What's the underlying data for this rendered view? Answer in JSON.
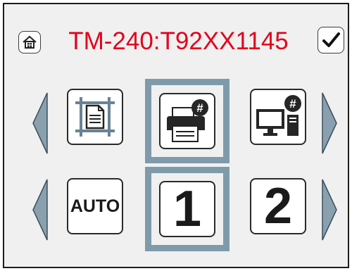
{
  "header": {
    "title": "TM-240:T92XX1145",
    "title_color": "#e3001b",
    "home_icon": "home-icon",
    "confirm_icon": "checkmark-icon"
  },
  "row1": {
    "left_arrow_icon": "left-arrow-icon",
    "right_arrow_icon": "right-arrow-icon",
    "items": [
      {
        "icon": "document-layout-icon",
        "badge": ""
      },
      {
        "icon": "printer-icon",
        "badge": "#"
      },
      {
        "icon": "computer-icon",
        "badge": "#"
      }
    ],
    "selected_index": 1
  },
  "row2": {
    "left_arrow_icon": "left-arrow-icon",
    "right_arrow_icon": "right-arrow-icon",
    "items": [
      {
        "label": "AUTO"
      },
      {
        "label": "1"
      },
      {
        "label": "2"
      }
    ],
    "selected_index": 1
  },
  "colors": {
    "selection_frame": "#7f9aab",
    "arrow": "#8aa0af",
    "panel": "#f0f0f0"
  }
}
